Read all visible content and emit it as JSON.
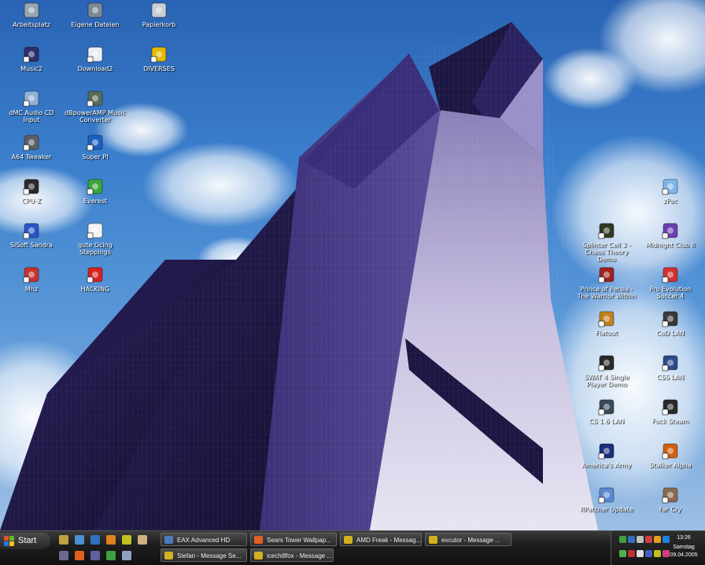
{
  "desktop": {
    "left_icons": [
      {
        "name": "icon-arbeitsplatz",
        "label": "Arbeitsplatz",
        "icon": "my-computer-icon",
        "color": "#9aa4b0"
      },
      {
        "name": "icon-eigene-dateien",
        "label": "Eigene Dateien",
        "icon": "my-documents-icon",
        "color": "#7d8a96"
      },
      {
        "name": "icon-papierkorb",
        "label": "Papierkorb",
        "icon": "recycle-bin-icon",
        "color": "#c8cdd2"
      },
      {
        "name": "icon-music2",
        "label": "Music2",
        "icon": "music-folder-icon",
        "color": "#2b2f6b"
      },
      {
        "name": "icon-download2",
        "label": "Download2",
        "icon": "at-sign-icon",
        "color": "#e8eef5"
      },
      {
        "name": "icon-diverses",
        "label": "DIVERSES",
        "icon": "lock-icon",
        "color": "#e6b800"
      },
      {
        "name": "icon-dmc-audio",
        "label": "dMC Audio CD Input",
        "icon": "cd-icon",
        "color": "#8fb0d8"
      },
      {
        "name": "icon-dbpoweramp",
        "label": "dBpowerAMP Music Converter",
        "icon": "speaker-icon",
        "color": "#5a6b5a"
      },
      {
        "name": "icon-a64-tweaker",
        "label": "A64 Tweaker",
        "icon": "tools-icon",
        "color": "#5c6066"
      },
      {
        "name": "icon-super-pi",
        "label": "Super PI",
        "icon": "super-pi-icon",
        "color": "#1e5fbf"
      },
      {
        "name": "icon-cpu-z",
        "label": "CPU-Z",
        "icon": "cpu-icon",
        "color": "#2a2a2a"
      },
      {
        "name": "icon-everest",
        "label": "Everest",
        "icon": "info-icon",
        "color": "#3aa63a"
      },
      {
        "name": "icon-sisoft-sandra",
        "label": "SiSoft Sandra",
        "icon": "sandra-icon",
        "color": "#2a56c6"
      },
      {
        "name": "icon-gute-ocing",
        "label": "gute Ocing Steppings",
        "icon": "text-file-icon",
        "color": "#f2f2f2"
      },
      {
        "name": "icon-mhz",
        "label": "Mhz",
        "icon": "wcpuid-icon",
        "color": "#c83232"
      },
      {
        "name": "icon-hacking",
        "label": "HACKING",
        "icon": "forbidden-icon",
        "color": "#d92020"
      }
    ],
    "right_icons": [
      {
        "name": "icon-zpac",
        "label": "zPac",
        "icon": "document-icon",
        "color": "#7fb6e8"
      },
      {
        "name": "icon-splinter-cell",
        "label": "Splinter Cell 3 - Chaos Theory Demo",
        "icon": "goggles-icon",
        "color": "#2f3a22"
      },
      {
        "name": "icon-midnight-club",
        "label": "Midnight Club II",
        "icon": "midnight-club-icon",
        "color": "#6b3fb0"
      },
      {
        "name": "icon-prince-of-persia",
        "label": "Prince of Persia - The Warrior Within",
        "icon": "pop-icon",
        "color": "#a02020"
      },
      {
        "name": "icon-pes4",
        "label": "Pro Evolution Soccer 4",
        "icon": "pes-icon",
        "color": "#d03030"
      },
      {
        "name": "icon-flatout",
        "label": "Flatout",
        "icon": "flatout-icon",
        "color": "#c08020"
      },
      {
        "name": "icon-cod-lan",
        "label": "CoD LAN",
        "icon": "star-icon",
        "color": "#3a3a3a"
      },
      {
        "name": "icon-swat4",
        "label": "SWAT 4 Single Player Demo",
        "icon": "swat-icon",
        "color": "#2a2a2a"
      },
      {
        "name": "icon-css-lan",
        "label": "CSS LAN",
        "icon": "steam-icon",
        "color": "#2c4a8a"
      },
      {
        "name": "icon-cs16-lan",
        "label": "CS 1.6 LAN",
        "icon": "cs-icon",
        "color": "#3a4a5a"
      },
      {
        "name": "icon-fuck-steam",
        "label": "Fuck Steam",
        "icon": "fuck-steam-icon",
        "color": "#2a2a2a"
      },
      {
        "name": "icon-americas-army",
        "label": "America's Army",
        "icon": "americas-army-icon",
        "color": "#1c2f7a"
      },
      {
        "name": "icon-stalker-alpha",
        "label": "Stalker Alpha",
        "icon": "stalker-icon",
        "color": "#d06010"
      },
      {
        "name": "icon-rpatcher",
        "label": "RPatcher Update",
        "icon": "patcher-icon",
        "color": "#5a8ad0"
      },
      {
        "name": "icon-far-cry",
        "label": "Far Cry",
        "icon": "far-cry-icon",
        "color": "#8a6a50"
      }
    ]
  },
  "taskbar": {
    "start_label": "Start",
    "quick_launch": [
      {
        "name": "ql-icon-1",
        "icon": "bricks-icon",
        "color": "#c0a040"
      },
      {
        "name": "ql-icon-2",
        "icon": "desktop-icon",
        "color": "#4a90d0"
      },
      {
        "name": "ql-icon-3",
        "icon": "explorer-icon",
        "color": "#3070c0"
      },
      {
        "name": "ql-icon-4",
        "icon": "burn-icon",
        "color": "#e08020"
      },
      {
        "name": "ql-icon-5",
        "icon": "flower-icon",
        "color": "#c0c020"
      },
      {
        "name": "ql-icon-6",
        "icon": "mushroom-icon",
        "color": "#d0b080"
      },
      {
        "name": "ql-icon-7",
        "icon": "media-player-icon",
        "color": "#6a6a90"
      },
      {
        "name": "ql-icon-8",
        "icon": "firefox-icon",
        "color": "#e06020"
      },
      {
        "name": "ql-icon-9",
        "icon": "tool-icon",
        "color": "#6060a0"
      },
      {
        "name": "ql-icon-10",
        "icon": "network-icon",
        "color": "#40a040"
      },
      {
        "name": "ql-icon-11",
        "icon": "wrench-icon",
        "color": "#90a0c0"
      }
    ],
    "tasks": [
      {
        "name": "task-eax",
        "label": "EAX Advanced HD",
        "icon": "window-icon",
        "color": "#4a7ac0"
      },
      {
        "name": "task-sears-tower",
        "label": "Sears Tower Wallpap...",
        "icon": "firefox-icon",
        "color": "#e06020"
      },
      {
        "name": "task-amd-freak",
        "label": "AMD Freak - Messag...",
        "icon": "im-icon",
        "color": "#d0b020"
      },
      {
        "name": "task-excutor",
        "label": "excutor - Message ...",
        "icon": "im-icon",
        "color": "#d0b020"
      },
      {
        "name": "task-stefan",
        "label": "Stefan - Message Se...",
        "icon": "im-icon",
        "color": "#d0b020"
      },
      {
        "name": "task-icechillfox",
        "label": "icechillfox - Message ...",
        "icon": "im-icon",
        "color": "#d0b020"
      }
    ],
    "tray": {
      "time": "13:26",
      "day": "Samstag",
      "date": "09.04.2005"
    }
  },
  "colors": {
    "taskbar_dark": "#1d1d1d",
    "sky": "#3b7fcc",
    "tower_dark": "#1c1640"
  }
}
